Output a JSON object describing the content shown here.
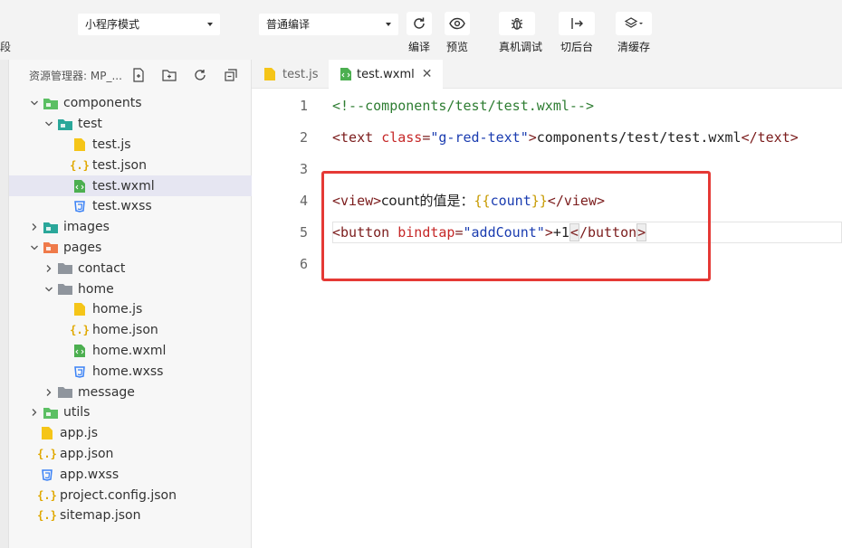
{
  "toolbar": {
    "edge_label": "段",
    "mode_select": "小程序模式",
    "compile_select": "普通编译",
    "buttons": [
      {
        "label": "编译",
        "icon": "refresh-icon"
      },
      {
        "label": "预览",
        "icon": "eye-icon"
      },
      {
        "label": "真机调试",
        "icon": "bug-icon"
      },
      {
        "label": "切后台",
        "icon": "switch-background-icon"
      },
      {
        "label": "清缓存",
        "icon": "layers-icon"
      }
    ]
  },
  "sidebar": {
    "title": "资源管理器: MP_...",
    "tree": [
      {
        "label": "components",
        "type": "folder-green",
        "open": true,
        "depth": 0
      },
      {
        "label": "test",
        "type": "folder-teal",
        "open": true,
        "depth": 1
      },
      {
        "label": "test.js",
        "type": "js",
        "depth": 2
      },
      {
        "label": "test.json",
        "type": "json",
        "depth": 2
      },
      {
        "label": "test.wxml",
        "type": "wxml",
        "depth": 2,
        "selected": true
      },
      {
        "label": "test.wxss",
        "type": "wxss",
        "depth": 2
      },
      {
        "label": "images",
        "type": "folder-teal",
        "open": false,
        "depth": 0
      },
      {
        "label": "pages",
        "type": "folder-orange",
        "open": true,
        "depth": 0
      },
      {
        "label": "contact",
        "type": "folder-gray",
        "open": false,
        "depth": 1
      },
      {
        "label": "home",
        "type": "folder-gray",
        "open": true,
        "depth": 1
      },
      {
        "label": "home.js",
        "type": "js",
        "depth": 2
      },
      {
        "label": "home.json",
        "type": "json",
        "depth": 2
      },
      {
        "label": "home.wxml",
        "type": "wxml",
        "depth": 2
      },
      {
        "label": "home.wxss",
        "type": "wxss",
        "depth": 2
      },
      {
        "label": "message",
        "type": "folder-gray",
        "open": false,
        "depth": 1
      },
      {
        "label": "utils",
        "type": "folder-green",
        "open": false,
        "depth": 0
      },
      {
        "label": "app.js",
        "type": "js",
        "depth": 0,
        "leaf": true
      },
      {
        "label": "app.json",
        "type": "json",
        "depth": 0,
        "leaf": true
      },
      {
        "label": "app.wxss",
        "type": "wxss",
        "depth": 0,
        "leaf": true
      },
      {
        "label": "project.config.json",
        "type": "json",
        "depth": 0,
        "leaf": true
      },
      {
        "label": "sitemap.json",
        "type": "json",
        "depth": 0,
        "leaf": true
      }
    ]
  },
  "editor": {
    "tabs": [
      {
        "label": "test.js",
        "type": "js",
        "active": false
      },
      {
        "label": "test.wxml",
        "type": "wxml",
        "active": true
      }
    ],
    "line_numbers": [
      "1",
      "2",
      "3",
      "4",
      "5",
      "6"
    ],
    "code": {
      "l1": "<!--components/test/test.wxml-->",
      "l2_open": "<text",
      "l2_attr": "class",
      "l2_eq": "=",
      "l2_val": "\"g-red-text\"",
      "l2_gt": ">",
      "l2_text": "components/test/test.wxml",
      "l2_close": "</text>",
      "l4_open": "<view>",
      "l4_text": "count的值是：",
      "l4_lbrace": "{{",
      "l4_expr": "count",
      "l4_rbrace": "}}",
      "l4_close": "</view>",
      "l5_open": "<button",
      "l5_attr": "bindtap",
      "l5_eq": "=",
      "l5_val": "\"addCount\"",
      "l5_gt": ">",
      "l5_text": "+1",
      "l5_close_lt": "<",
      "l5_close": "/button",
      "l5_close_gt": ">"
    }
  },
  "colors": {
    "highlight_box": "#e53935",
    "selected_row": "#e6e6f2"
  }
}
